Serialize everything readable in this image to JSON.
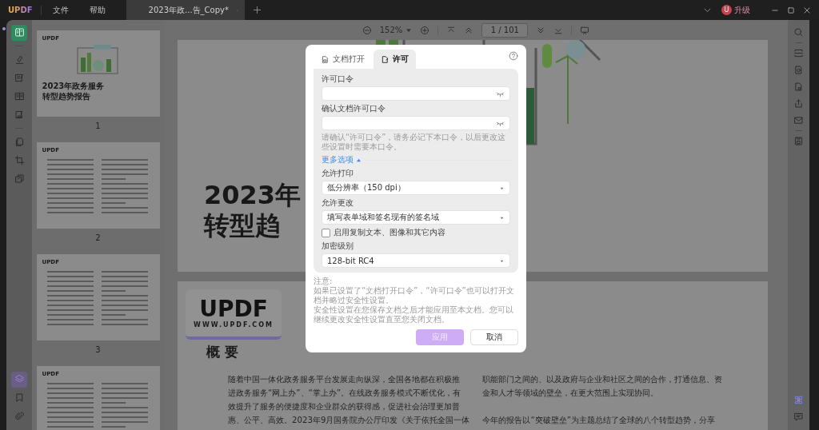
{
  "title_bar": {
    "logo": "UPDF",
    "menus": [
      "文件",
      "帮助"
    ],
    "tabs": [
      {
        "label": "2023年政...告_Copy*",
        "selected": true
      }
    ],
    "account": {
      "avatar": "U",
      "upgrade": "升级"
    }
  },
  "left_toolbar": {
    "top_tools": [
      {
        "selected": true
      },
      {
        "selected": false
      },
      {
        "selected": false
      },
      {
        "selected": false
      },
      {
        "selected": false
      },
      {
        "selected": false
      },
      {
        "selected": false
      },
      {
        "selected": false
      }
    ],
    "bottom_tools": [
      {
        "selected": true
      },
      {
        "selected": false
      },
      {
        "selected": false
      }
    ]
  },
  "thumbnails": [
    {
      "kind": "cover",
      "logo": "UPDF",
      "title_lines": [
        "2023年政务服务",
        "转型趋势报告"
      ],
      "label": "1"
    },
    {
      "kind": "text",
      "logo": "UPDF",
      "label": "2"
    },
    {
      "kind": "text",
      "logo": "UPDF",
      "label": "3"
    },
    {
      "kind": "text",
      "logo": "UPDF"
    }
  ],
  "doc_toolbar": {
    "zoom": "152%",
    "page_indicator": "1 / 101"
  },
  "document": {
    "cover": {
      "title_lines": [
        "2023年",
        "转型趋"
      ]
    },
    "summary": {
      "logo": "UPDF",
      "url": "WWW.UPDF.COM",
      "heading": "概 要",
      "left_lines": [
        "随着中国一体化政务服务平台发展走向纵深，全国各地都在积极推",
        "进政务服务“网上办”、“掌上办”。在线政务服务模式不断优化，有",
        "效提升了服务的便捷度和企业群众的获得感，促进社会治理更加普",
        "惠、公平、高效。2023年9月国务院办公厅印发《关于依托全国一体"
      ],
      "right_paragraphs": [
        [
          "职能部门之间的、以及政府与企业和社区之间的合作，打通信息、资",
          "金和人才等领域的壁垒，在更大范围上实现协同。"
        ],
        [
          "今年的报告以“突破壁垒”为主题总结了全球的八个转型趋势，分享"
        ]
      ]
    }
  },
  "dialog": {
    "tabs": [
      {
        "label": "文档打开",
        "selected": false
      },
      {
        "label": "许可",
        "selected": true
      }
    ],
    "items": [
      {
        "kind": "password",
        "label": "许可口令"
      },
      {
        "kind": "password",
        "label": "确认文档许可口令"
      },
      {
        "kind": "hint",
        "text": "请确认“许可口令”，请务必记下本口令，以后更改这些设置时需要本口令。"
      },
      {
        "kind": "toggle",
        "label": "更多选项",
        "expanded": true
      },
      {
        "kind": "select",
        "label": "允许打印",
        "value": "低分辨率（150 dpi）"
      },
      {
        "kind": "select",
        "label": "允许更改",
        "value": "填写表单域和签名现有的签名域"
      },
      {
        "kind": "checkbox",
        "label": "启用复制文本、图像和其它内容",
        "checked": false
      },
      {
        "kind": "select",
        "label": "加密级别",
        "value": "128-bit RC4"
      }
    ],
    "note_title": "注意:",
    "notes": [
      "如果已设置了“文档打开口令”，“许可口令”也可以打开文档并略过安全性设置。",
      "安全性设置在您保存文档之后才能应用至本文档。您可以继续更改安全性设置直至您关闭文档。"
    ],
    "buttons": [
      {
        "label": "应用",
        "kind": "primary",
        "disabled": true
      },
      {
        "label": "取消",
        "kind": "secondary",
        "disabled": false
      }
    ]
  }
}
